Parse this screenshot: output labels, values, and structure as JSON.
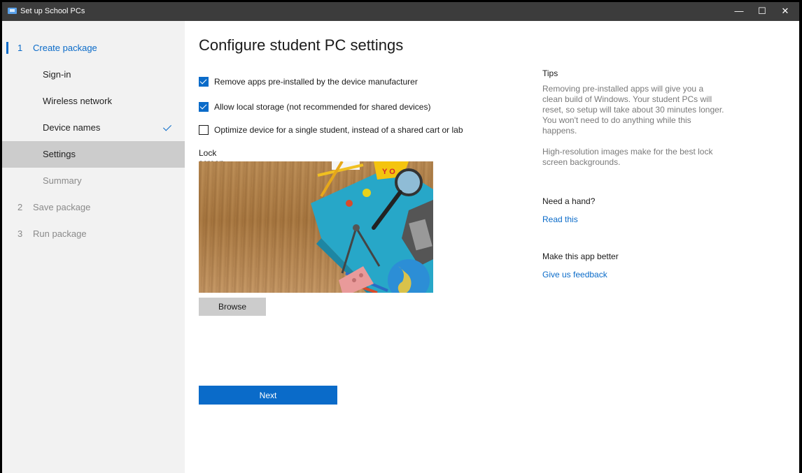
{
  "window": {
    "title": "Set up School PCs",
    "controls": {
      "minimize": "—",
      "maximize": "☐",
      "close": "✕"
    }
  },
  "sidebar": {
    "steps": [
      {
        "number": "1",
        "label": "Create package"
      },
      {
        "number": "2",
        "label": "Save package"
      },
      {
        "number": "3",
        "label": "Run package"
      }
    ],
    "substeps": [
      {
        "label": "Sign-in"
      },
      {
        "label": "Wireless network"
      },
      {
        "label": "Device names",
        "completed": true
      },
      {
        "label": "Settings",
        "selected": true
      },
      {
        "label": "Summary"
      }
    ]
  },
  "main": {
    "title": "Configure student PC settings",
    "options": [
      {
        "label": "Remove apps pre-installed by the device manufacturer",
        "checked": true
      },
      {
        "label": "Allow local storage (not recommended for shared devices)",
        "checked": true
      },
      {
        "label": "Optimize device for a single student, instead of a shared cart or lab",
        "checked": false
      }
    ],
    "lock_screen_label": "Lock screen background",
    "browse_label": "Browse",
    "next_label": "Next"
  },
  "tips": {
    "heading": "Tips",
    "paragraphs": [
      "Removing pre-installed apps will give you a clean build of Windows. Your student PCs will reset, so setup will take about 30 minutes longer. You won't need to do anything while this happens.",
      "High-resolution images make for the best lock screen backgrounds."
    ],
    "help_heading": "Need a hand?",
    "help_link": "Read this",
    "feedback_heading": "Make this app better",
    "feedback_link": "Give us feedback"
  },
  "colors": {
    "accent": "#0a6bc9",
    "titlebar": "#3c3c3c",
    "sidebar": "#f2f2f2",
    "selected": "#cccccc"
  }
}
